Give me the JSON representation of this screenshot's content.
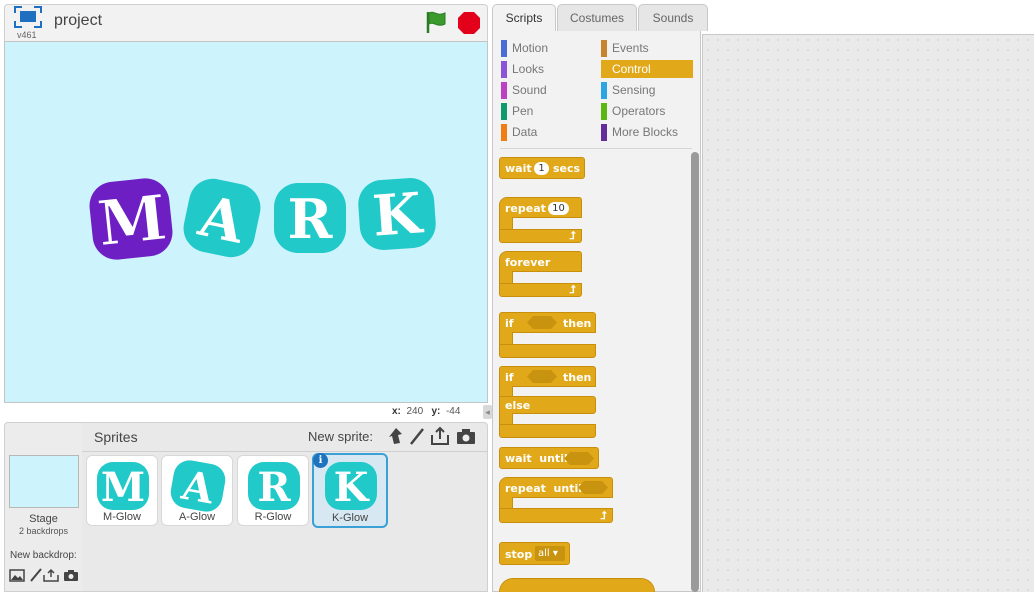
{
  "stage_header": {
    "project_title": "project",
    "version": "v461"
  },
  "stage": {
    "letters": [
      "M",
      "A",
      "R",
      "K"
    ],
    "colors": {
      "background": "#cdf3fd",
      "purple": "#6d1fc4",
      "teal": "#22c9c9"
    }
  },
  "coords": {
    "x_label": "x:",
    "x_value": "240",
    "y_label": "y:",
    "y_value": "-44"
  },
  "sprites_panel": {
    "title": "Sprites",
    "new_sprite_label": "New sprite:",
    "sprites": [
      {
        "letter": "M",
        "name": "M-Glow"
      },
      {
        "letter": "A",
        "name": "A-Glow"
      },
      {
        "letter": "R",
        "name": "R-Glow"
      },
      {
        "letter": "K",
        "name": "K-Glow"
      }
    ],
    "info_glyph": "i"
  },
  "stage_panel": {
    "label": "Stage",
    "backdrops": "2 backdrops",
    "new_backdrop_label": "New backdrop:"
  },
  "tabs": [
    "Scripts",
    "Costumes",
    "Sounds"
  ],
  "categories": [
    {
      "label": "Motion",
      "color": "#4a6cd4"
    },
    {
      "label": "Events",
      "color": "#c88330"
    },
    {
      "label": "Looks",
      "color": "#8a55d7"
    },
    {
      "label": "Control",
      "color": "#e1a91a"
    },
    {
      "label": "Sound",
      "color": "#bb42c3"
    },
    {
      "label": "Sensing",
      "color": "#2ca5e2"
    },
    {
      "label": "Pen",
      "color": "#0e9a6c"
    },
    {
      "label": "Operators",
      "color": "#5cb712"
    },
    {
      "label": "Data",
      "color": "#ee7d16"
    },
    {
      "label": "More Blocks",
      "color": "#632d99"
    }
  ],
  "blocks": {
    "wait": {
      "label": "wait",
      "value": "1",
      "suffix": "secs"
    },
    "repeat": {
      "label": "repeat",
      "value": "10"
    },
    "forever": {
      "label": "forever"
    },
    "if_then": {
      "label": "if",
      "then": "then"
    },
    "if_else": {
      "label": "if",
      "then": "then",
      "else": "else"
    },
    "wait_until": {
      "label": "wait  until"
    },
    "repeat_until": {
      "label": "repeat  until"
    },
    "stop": {
      "label": "stop",
      "value": "all"
    }
  }
}
